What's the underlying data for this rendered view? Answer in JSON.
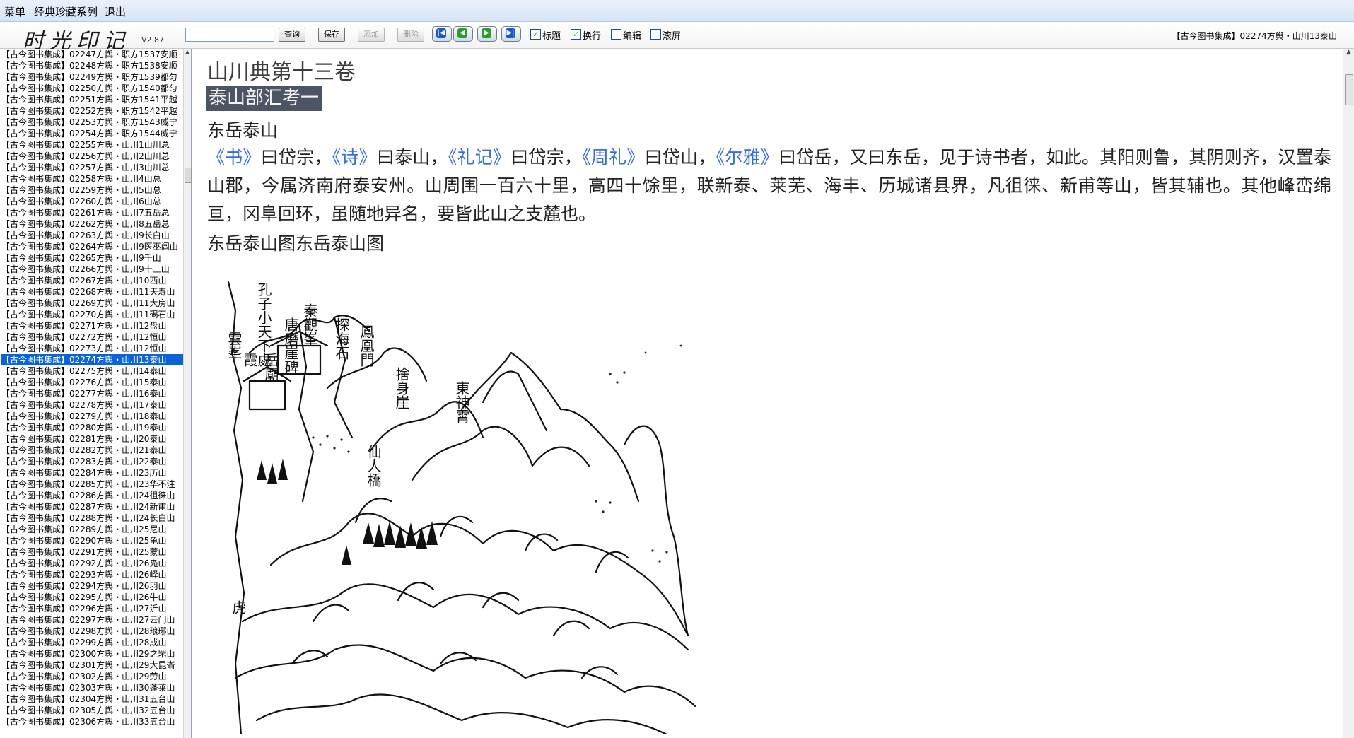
{
  "menu": {
    "items": [
      "菜单",
      "经典珍藏系列",
      "退出"
    ]
  },
  "toolbar": {
    "logo": "时光印记",
    "version": "V2.87",
    "search_value": "",
    "buttons": {
      "query": "查询",
      "save": "保存",
      "add": "添加",
      "delete": "删除"
    },
    "checkboxes": [
      {
        "label": "标题",
        "checked": true
      },
      {
        "label": "换行",
        "checked": true
      },
      {
        "label": "编辑",
        "checked": false
      },
      {
        "label": "滚屏",
        "checked": false
      }
    ],
    "current_doc_title": "【古今图书集成】02274方舆・山川13泰山"
  },
  "sidebar": {
    "selected_index": 27,
    "items": [
      "【古今图书集成】02247方舆・职方1537安顺",
      "【古今图书集成】02248方舆・职方1538安顺",
      "【古今图书集成】02249方舆・职方1539都匀",
      "【古今图书集成】02250方舆・职方1540都匀",
      "【古今图书集成】02251方舆・职方1541平越",
      "【古今图书集成】02252方舆・职方1542平越",
      "【古今图书集成】02253方舆・职方1543威宁",
      "【古今图书集成】02254方舆・职方1544威宁",
      "【古今图书集成】02255方舆・山川1山川总",
      "【古今图书集成】02256方舆・山川2山川总",
      "【古今图书集成】02257方舆・山川3山川总",
      "【古今图书集成】02258方舆・山川4山总",
      "【古今图书集成】02259方舆・山川5山总",
      "【古今图书集成】02260方舆・山川6山总",
      "【古今图书集成】02261方舆・山川7五岳总",
      "【古今图书集成】02262方舆・山川8五岳总",
      "【古今图书集成】02263方舆・山川9长白山",
      "【古今图书集成】02264方舆・山川9医巫闾山",
      "【古今图书集成】02265方舆・山川9千山",
      "【古今图书集成】02266方舆・山川9十三山",
      "【古今图书集成】02267方舆・山川10西山",
      "【古今图书集成】02268方舆・山川11天寿山",
      "【古今图书集成】02269方舆・山川11大房山",
      "【古今图书集成】02270方舆・山川11碣石山",
      "【古今图书集成】02271方舆・山川12盘山",
      "【古今图书集成】02272方舆・山川12恒山",
      "【古今图书集成】02273方舆・山川12恒山",
      "【古今图书集成】02274方舆・山川13泰山",
      "【古今图书集成】02275方舆・山川14泰山",
      "【古今图书集成】02276方舆・山川15泰山",
      "【古今图书集成】02277方舆・山川16泰山",
      "【古今图书集成】02278方舆・山川17泰山",
      "【古今图书集成】02279方舆・山川18泰山",
      "【古今图书集成】02280方舆・山川19泰山",
      "【古今图书集成】02281方舆・山川20泰山",
      "【古今图书集成】02282方舆・山川21泰山",
      "【古今图书集成】02283方舆・山川22泰山",
      "【古今图书集成】02284方舆・山川23历山",
      "【古今图书集成】02285方舆・山川23华不注",
      "【古今图书集成】02286方舆・山川24徂徕山",
      "【古今图书集成】02287方舆・山川24新甫山",
      "【古今图书集成】02288方舆・山川24长白山",
      "【古今图书集成】02289方舆・山川25尼山",
      "【古今图书集成】02290方舆・山川25龟山",
      "【古今图书集成】02291方舆・山川25蒙山",
      "【古今图书集成】02292方舆・山川26凫山",
      "【古今图书集成】02293方舆・山川26峄山",
      "【古今图书集成】02294方舆・山川26羽山",
      "【古今图书集成】02295方舆・山川26牛山",
      "【古今图书集成】02296方舆・山川27沂山",
      "【古今图书集成】02297方舆・山川27云门山",
      "【古今图书集成】02298方舆・山川28琅琊山",
      "【古今图书集成】02299方舆・山川28成山",
      "【古今图书集成】02300方舆・山川29之罘山",
      "【古今图书集成】02301方舆・山川29大昆嵛",
      "【古今图书集成】02302方舆・山川29劳山",
      "【古今图书集成】02303方舆・山川30蓬莱山",
      "【古今图书集成】02304方舆・山川31五台山",
      "【古今图书集成】02305方舆・山川32五台山",
      "【古今图书集成】02306方舆・山川33五台山"
    ]
  },
  "content": {
    "volume_title": "山川典第十三卷",
    "section_title": "泰山部汇考一",
    "subtitle": "东岳泰山",
    "paragraph": [
      {
        "t": "《书》",
        "ref": true
      },
      {
        "t": "曰岱宗，",
        "ref": false
      },
      {
        "t": "《诗》",
        "ref": true
      },
      {
        "t": "曰泰山，",
        "ref": false
      },
      {
        "t": "《礼记》",
        "ref": true
      },
      {
        "t": "曰岱宗，",
        "ref": false
      },
      {
        "t": "《周礼》",
        "ref": true
      },
      {
        "t": "曰岱山，",
        "ref": false
      },
      {
        "t": "《尔雅》",
        "ref": true
      },
      {
        "t": "曰岱岳，又曰东岳，见于诗书者，如此。其阳则鲁，其阴则齐，汉置泰山郡，今属济南府泰安州。山周围一百六十里，高四十馀里，联新泰、莱芜、海丰、历城诸县界，凡徂徕、新甫等山，皆其辅也。其他峰峦绵亘，冈阜回环，虽随地异名，要皆此山之支麓也。",
        "ref": false
      }
    ],
    "figure_heading": "东岳泰山图东岳泰山图",
    "figure_labels": [
      "孔子小天下處",
      "秦觀峯",
      "探海石",
      "鳳凰門",
      "唐磨崖碑",
      "捨身崖",
      "東神霄",
      "仙人橋",
      "雲峯",
      "岳廟",
      "霞",
      "虎"
    ]
  },
  "colors": {
    "selection": "#0a64d8",
    "reference_link": "#3a6fd0",
    "section_highlight": "#4b5563"
  }
}
